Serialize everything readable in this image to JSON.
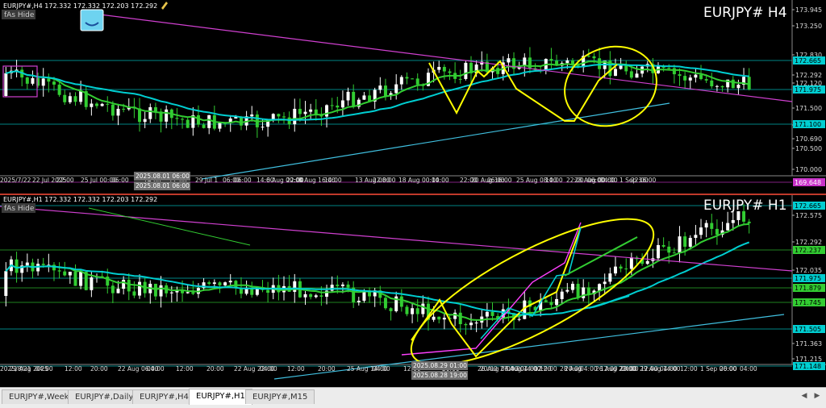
{
  "charts": [
    {
      "id": "h4",
      "header": "EURJPY#,H4  172.332 172.332 172.203 172.292",
      "title": "EURJPY# H4",
      "indicator_label": "fAs Hide",
      "price_labels": [
        "173.945",
        "173.250",
        "172.830",
        "172.292",
        "172.120",
        "171.500",
        "171.100",
        "170.690",
        "170.500",
        "170.000"
      ],
      "highlight_labels": [
        {
          "text": "172.665",
          "bg": "#00ced1",
          "fg": "#000000"
        },
        {
          "text": "171.975",
          "bg": "#00ced1",
          "fg": "#000000"
        },
        {
          "text": "171.100",
          "bg": "#00ced1",
          "fg": "#000000"
        },
        {
          "text": "169.648",
          "bg": "#c832c8",
          "fg": "#ffffff"
        }
      ],
      "time_labels": [
        "2025/7/22",
        "22 Jul 2025",
        "22:00",
        "25 Jul 00:00",
        "06:00",
        "14:00",
        "22:00",
        "29 Jul 1",
        "06:00",
        "14:00",
        "22:00",
        "06:00",
        "6 Aug 00:00",
        "8 Aug 16:00",
        "14:00",
        "13 Aug 08:00",
        "22:00",
        "18 Aug 00:00",
        "14:00",
        "22:00",
        "20 Aug 16:00",
        "06:00",
        "25 Aug 08:00",
        "14:00",
        "22:00",
        "28 Aug 00:00",
        "06:00",
        "14:00",
        "1 Sep 16:00",
        "22:00"
      ],
      "time_tooltips": [
        "2025.08.01 06:00",
        "2025.08.01 06:00"
      ]
    },
    {
      "id": "h1",
      "header": "EURJPY#,H1  172.332 172.332 172.203 172.292",
      "title": "EURJPY# H1",
      "indicator_label": "fAs Hide",
      "price_labels": [
        "172.575",
        "172.292",
        "172.035",
        "171.363",
        "171.215"
      ],
      "highlight_labels": [
        {
          "text": "172.665",
          "bg": "#00ced1",
          "fg": "#000000"
        },
        {
          "text": "172.237",
          "bg": "#32cd32",
          "fg": "#000000"
        },
        {
          "text": "171.975",
          "bg": "#00ced1",
          "fg": "#000000"
        },
        {
          "text": "171.879",
          "bg": "#32cd32",
          "fg": "#000000"
        },
        {
          "text": "171.745",
          "bg": "#32cd32",
          "fg": "#000000"
        },
        {
          "text": "171.505",
          "bg": "#00ced1",
          "fg": "#000000"
        },
        {
          "text": "171.148",
          "bg": "#00ced1",
          "fg": "#000000"
        }
      ],
      "time_labels": [
        "2025/8/21",
        "21 Aug 2025",
        "04:00",
        "12:00",
        "20:00",
        "22 Aug 06:00",
        "04:00",
        "12:00",
        "20:00",
        "22 Aug 22:00",
        "04:00",
        "12:00",
        "20:00",
        "25 Aug 14:00",
        "04:00",
        "12:00",
        "20:00",
        "26 Aug 06:00",
        "04:00",
        "12:00",
        "20:00",
        "26 Aug 22:00",
        "04:00",
        "12:00",
        "20:00",
        "27 Aug 14:00",
        "04:00",
        "12:00",
        "28 Aug",
        "04:00",
        "12:00",
        "20:00",
        "29 Aug 14:00",
        "04:00",
        "12:00",
        "1 Sep 06:00",
        "20:00",
        "04:00",
        "1 Sep 22:00"
      ],
      "time_tooltips": [
        "2025.08.29 01:00",
        "2025.08.28 19:00"
      ]
    }
  ],
  "tabs": [
    "EURJPY#,Weekly",
    "EURJPY#,Daily",
    "EURJPY#,H4",
    "EURJPY#,H1",
    "EURJPY#,M15"
  ],
  "active_tab": "EURJPY#,H1",
  "colors": {
    "background": "#000000",
    "bull_candle": "#ffffff",
    "bear_candle": "#32cd32",
    "ma_fast": "#32cd32",
    "ma_slow": "#00ced1",
    "trendline": "#d040d0",
    "support_line": "#40c0e0",
    "annotation": "#ffff00",
    "separator": "#c0392b"
  }
}
